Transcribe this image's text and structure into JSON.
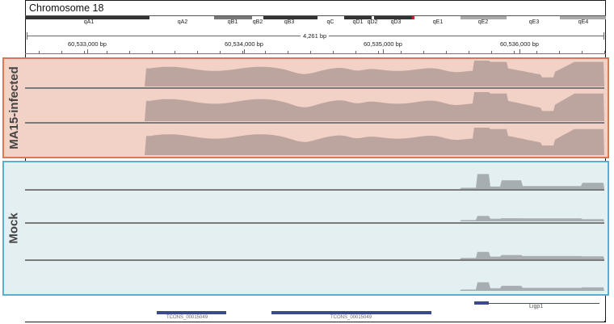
{
  "chromosome": {
    "title": "Chromosome 18",
    "bands": [
      "qA1",
      "qA2",
      "qB1",
      "qB2",
      "qB3",
      "qC",
      "qD1",
      "qD2",
      "qD3",
      "qE1",
      "qE2",
      "qE3",
      "qE4"
    ]
  },
  "ruler": {
    "span": "4,261 bp",
    "positions": [
      "60,533,000 bp",
      "60,534,000 bp",
      "60,535,000 bp",
      "60,536,000 bp"
    ]
  },
  "groups": {
    "infected": {
      "label": "MA15-infected",
      "color": "#bda59f",
      "border": "#d97856",
      "tracks": 3
    },
    "mock": {
      "label": "Mock",
      "color": "#a6aeb2",
      "border": "#5aafcf",
      "tracks": 4
    }
  },
  "genes": {
    "left_label": "TCONS_00015049",
    "right_label": "TCONS_00015049",
    "lbp_label": "Ligp1"
  }
}
